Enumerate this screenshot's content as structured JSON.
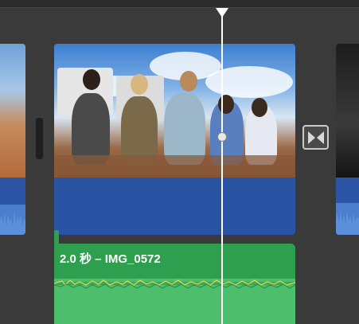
{
  "timeline": {
    "audio_clip": {
      "label": "2.0 秒 – IMG_0572",
      "color": "#4cbe6c"
    },
    "video_clip": {
      "audio_color": "#2b53a4"
    },
    "icons": {
      "playhead": "playhead-marker-icon",
      "transition": "bowtie-transition-icon"
    },
    "colors": {
      "background": "#3a3a3a",
      "playhead": "#ffffff",
      "audio_wave": "#f2d24a"
    }
  }
}
